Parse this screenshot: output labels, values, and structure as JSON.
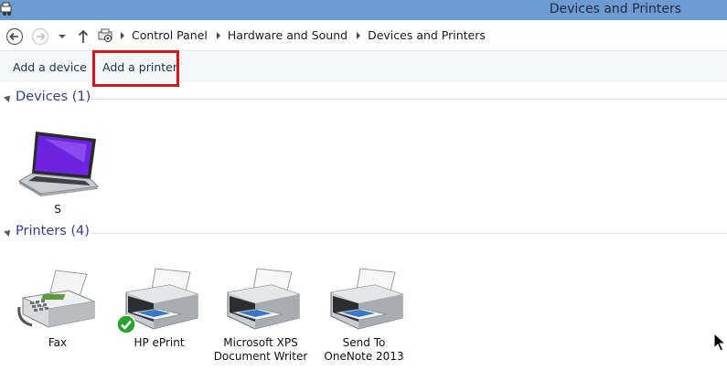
{
  "window": {
    "title": "Devices and Printers",
    "app_icon": "devices-printers-icon"
  },
  "navigation": {
    "back_icon": "back-arrow-icon",
    "forward_icon": "forward-arrow-icon",
    "recent_icon": "chevron-down-icon",
    "up_icon": "up-arrow-icon",
    "breadcrumbs": [
      "Control Panel",
      "Hardware and Sound",
      "Devices and Printers"
    ]
  },
  "commands": {
    "add_device": "Add a device",
    "add_printer": "Add a printer",
    "highlight_color": "#d9141b"
  },
  "groups": {
    "devices": {
      "title": "Devices (1)",
      "items": [
        {
          "label_line1": "S",
          "label_line2": "",
          "icon": "laptop-icon"
        }
      ]
    },
    "printers": {
      "title": "Printers (4)",
      "items": [
        {
          "label_line1": "Fax",
          "label_line2": "",
          "icon": "fax-icon"
        },
        {
          "label_line1": "HP ePrint",
          "label_line2": "",
          "icon": "printer-icon",
          "default": true
        },
        {
          "label_line1": "Microsoft XPS",
          "label_line2": "Document Writer",
          "icon": "printer-icon"
        },
        {
          "label_line1": "Send To",
          "label_line2": "OneNote 2013",
          "icon": "printer-icon"
        }
      ]
    }
  },
  "colors": {
    "titlebar": "#6f9bd3",
    "group_title": "#3a3a8a",
    "default_check": "#27a32e"
  }
}
